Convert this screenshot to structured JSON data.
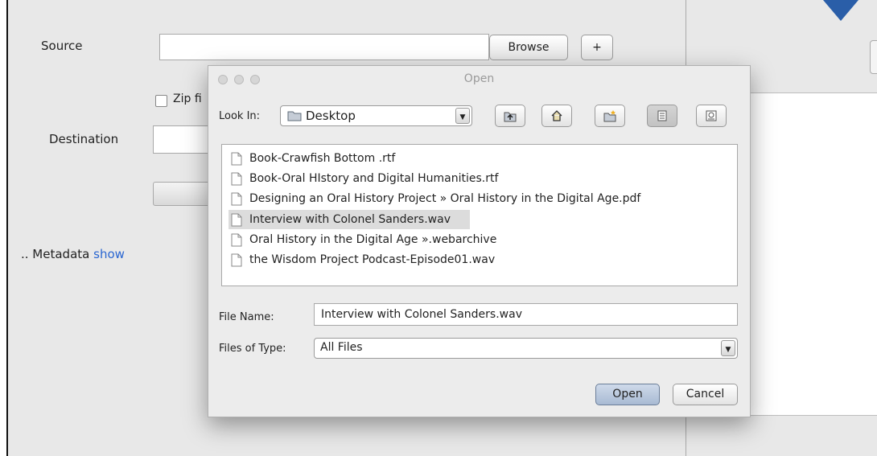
{
  "main": {
    "source_label": "Source",
    "browse_label": "Browse",
    "add_label": "+",
    "zip_label": "Zip fi",
    "destination_label": "Destination",
    "metadata_prefix": ".. Metadata",
    "metadata_link": "show"
  },
  "dialog": {
    "title": "Open",
    "look_in_label": "Look In:",
    "look_in_value": "Desktop",
    "files": [
      {
        "name": "Book-Crawfish Bottom .rtf",
        "selected": false
      },
      {
        "name": "Book-Oral HIstory and Digital Humanities.rtf",
        "selected": false
      },
      {
        "name": "Designing an Oral History Project » Oral History in the Digital Age.pdf",
        "selected": false
      },
      {
        "name": "Interview with Colonel Sanders.wav",
        "selected": true
      },
      {
        "name": "Oral History in the Digital Age ».webarchive",
        "selected": false
      },
      {
        "name": "the Wisdom Project Podcast-Episode01.wav",
        "selected": false
      }
    ],
    "file_name_label": "File Name:",
    "file_name_value": "Interview with Colonel Sanders.wav",
    "file_type_label": "Files of Type:",
    "file_type_value": "All Files",
    "open_label": "Open",
    "cancel_label": "Cancel"
  },
  "colors": {
    "accent": "#2a5ea8",
    "link": "#2a66d1",
    "selection": "#dcdcdc"
  }
}
